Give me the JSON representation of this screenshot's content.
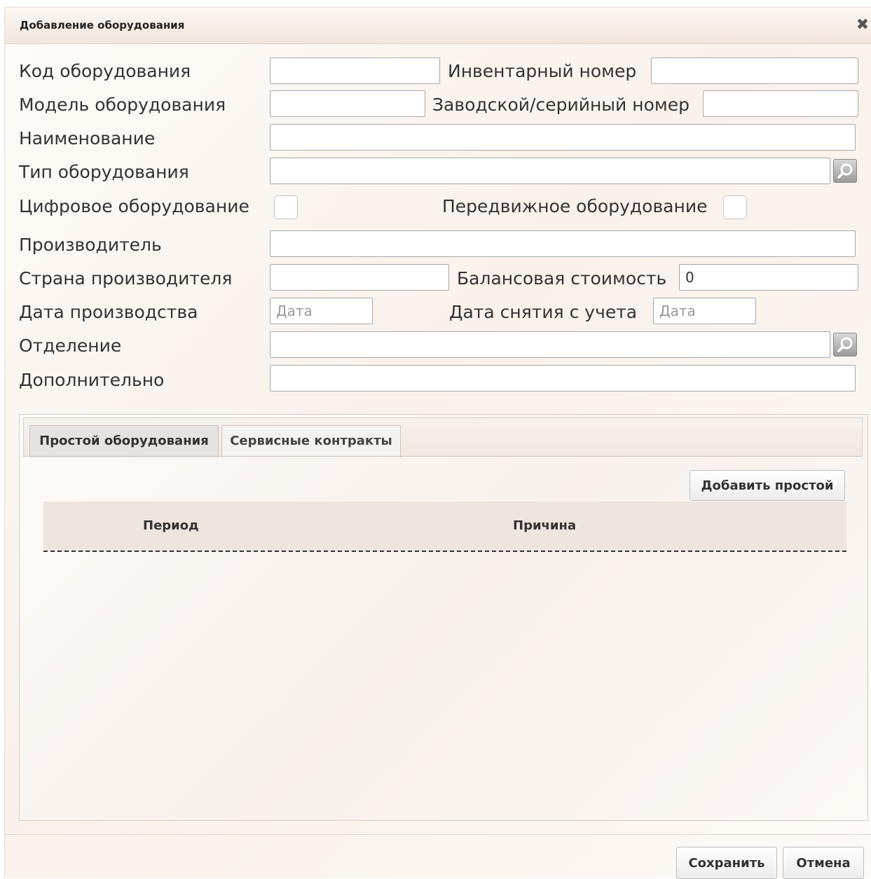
{
  "dialog": {
    "title": "Добавление оборудования",
    "close_glyph": "✖"
  },
  "form": {
    "code_label": "Код оборудования",
    "code_value": "",
    "inventory_label": "Инвентарный номер",
    "inventory_value": "",
    "model_label": "Модель оборудования",
    "model_value": "",
    "serial_label": "Заводской/серийный номер",
    "serial_value": "",
    "name_label": "Наименование",
    "name_value": "",
    "type_label": "Тип оборудования",
    "type_value": "",
    "digital_label": "Цифровое оборудование",
    "digital_checked": false,
    "mobile_label": "Передвижное оборудование",
    "mobile_checked": false,
    "manufacturer_label": "Производитель",
    "manufacturer_value": "",
    "country_label": "Страна производителя",
    "country_value": "",
    "balance_label": "Балансовая стоимость",
    "balance_value": "0",
    "prod_date_label": "Дата производства",
    "prod_date_placeholder": "Дата",
    "dereg_date_label": "Дата снятия с учета",
    "dereg_date_placeholder": "Дата",
    "department_label": "Отделение",
    "department_value": "",
    "extra_label": "Дополнительно",
    "extra_value": ""
  },
  "tabs": [
    {
      "label": "Простой оборудования",
      "active": true
    },
    {
      "label": "Сервисные контракты",
      "active": false
    }
  ],
  "downtime": {
    "add_button": "Добавить простой",
    "columns": [
      "Период",
      "Причина"
    ]
  },
  "footer": {
    "save_button": "Сохранить",
    "cancel_button": "Отмена"
  }
}
